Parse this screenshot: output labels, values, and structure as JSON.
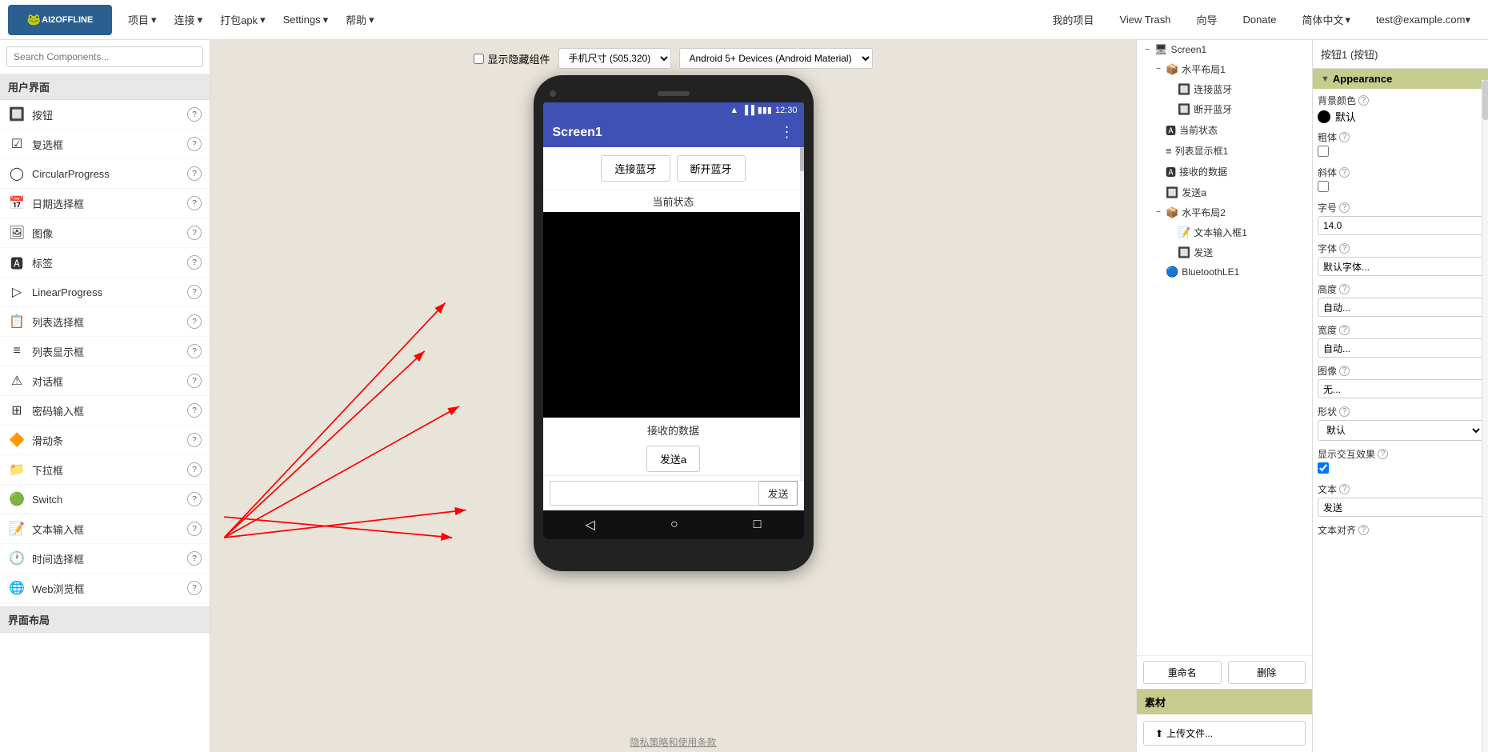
{
  "navbar": {
    "logo_text": "AI2OFFLINE",
    "menus": [
      {
        "label": "项目",
        "has_arrow": true
      },
      {
        "label": "连接",
        "has_arrow": true
      },
      {
        "label": "打包apk",
        "has_arrow": true
      },
      {
        "label": "Settings",
        "has_arrow": true
      },
      {
        "label": "帮助",
        "has_arrow": true
      }
    ],
    "right_items": [
      {
        "label": "我的项目"
      },
      {
        "label": "View Trash"
      },
      {
        "label": "向导"
      },
      {
        "label": "Donate"
      },
      {
        "label": "简体中文",
        "has_arrow": true
      },
      {
        "label": "test@example.com",
        "has_arrow": true
      }
    ]
  },
  "sidebar": {
    "search_placeholder": "Search Components...",
    "section1_label": "用户界面",
    "items": [
      {
        "label": "按钮",
        "icon": "🔲"
      },
      {
        "label": "复选框",
        "icon": "☑"
      },
      {
        "label": "CircularProgress",
        "icon": "○"
      },
      {
        "label": "日期选择框",
        "icon": "📅"
      },
      {
        "label": "图像",
        "icon": "🖼"
      },
      {
        "label": "标签",
        "icon": "🅰"
      },
      {
        "label": "LinearProgress",
        "icon": "▶"
      },
      {
        "label": "列表选择框",
        "icon": "📋"
      },
      {
        "label": "列表显示框",
        "icon": "≡"
      },
      {
        "label": "对话框",
        "icon": "⚠"
      },
      {
        "label": "密码输入框",
        "icon": "⊞"
      },
      {
        "label": "滑动条",
        "icon": "🔶"
      },
      {
        "label": "下拉框",
        "icon": "📁"
      },
      {
        "label": "Switch",
        "icon": "🟢"
      },
      {
        "label": "文本输入框",
        "icon": "📝"
      },
      {
        "label": "时间选择框",
        "icon": "🕐"
      },
      {
        "label": "Web浏览框",
        "icon": "🌐"
      }
    ],
    "section2_label": "界面布局"
  },
  "center": {
    "checkbox_label": "显示隐藏组件",
    "size_label": "手机尺寸 (505,320)",
    "device_label": "Android 5+ Devices (Android Material)",
    "phone": {
      "time": "12:30",
      "app_title": "Screen1",
      "btn1": "连接蓝牙",
      "btn2": "断开蓝牙",
      "status_label": "当前状态",
      "received_label": "接收的数据",
      "send_label_center": "发送a",
      "send_btn": "发送",
      "nav_back": "◁",
      "nav_home": "○",
      "nav_square": "□"
    },
    "footer_link": "隐私策略和使用条款"
  },
  "tree": {
    "items": [
      {
        "label": "Screen1",
        "indent": 0,
        "icon": "🖥",
        "expand": "−"
      },
      {
        "label": "水平布局1",
        "indent": 1,
        "icon": "📦",
        "expand": "−"
      },
      {
        "label": "连接蓝牙",
        "indent": 2,
        "icon": "🔲",
        "expand": ""
      },
      {
        "label": "断开蓝牙",
        "indent": 2,
        "icon": "🔲",
        "expand": ""
      },
      {
        "label": "当前状态",
        "indent": 1,
        "icon": "🅰",
        "expand": ""
      },
      {
        "label": "列表显示框1",
        "indent": 1,
        "icon": "≡",
        "expand": ""
      },
      {
        "label": "接收的数据",
        "indent": 1,
        "icon": "🅰",
        "expand": ""
      },
      {
        "label": "发送a",
        "indent": 1,
        "icon": "🔲",
        "expand": ""
      },
      {
        "label": "水平布局2",
        "indent": 1,
        "icon": "📦",
        "expand": "−"
      },
      {
        "label": "文本输入框1",
        "indent": 2,
        "icon": "📝",
        "expand": ""
      },
      {
        "label": "发送",
        "indent": 2,
        "icon": "🔲",
        "expand": ""
      },
      {
        "label": "BluetoothLE1",
        "indent": 1,
        "icon": "🔵",
        "expand": ""
      }
    ],
    "rename_btn": "重命名",
    "delete_btn": "删除",
    "assets_label": "素材",
    "upload_btn": "上传文件..."
  },
  "props": {
    "header": "按钮1 (按钮)",
    "section_label": "Appearance",
    "fields": [
      {
        "label": "背景颜色",
        "type": "color",
        "value": "默认",
        "color": "#000000"
      },
      {
        "label": "粗体",
        "type": "checkbox",
        "checked": false
      },
      {
        "label": "斜体",
        "type": "checkbox",
        "checked": false
      },
      {
        "label": "字号",
        "type": "text",
        "value": "14.0"
      },
      {
        "label": "字体",
        "type": "text",
        "value": "默认字体..."
      },
      {
        "label": "高度",
        "type": "text",
        "value": "自动..."
      },
      {
        "label": "宽度",
        "type": "text",
        "value": "自动..."
      },
      {
        "label": "图像",
        "type": "text",
        "value": "无..."
      },
      {
        "label": "形状",
        "type": "select",
        "value": "默认"
      },
      {
        "label": "显示交互效果",
        "type": "checkbox",
        "checked": true
      },
      {
        "label": "文本",
        "type": "text",
        "value": "发送"
      },
      {
        "label": "文本对齐",
        "type": "text",
        "value": ""
      }
    ]
  }
}
